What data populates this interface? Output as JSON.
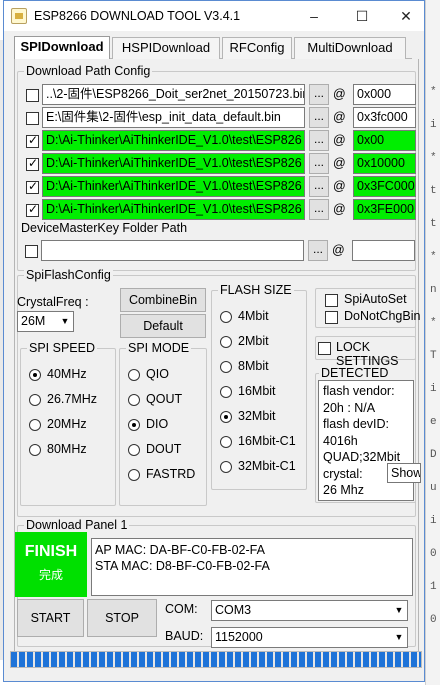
{
  "window": {
    "title": "ESP8266 DOWNLOAD TOOL V3.4.1",
    "minimize": "–",
    "maximize": "☐",
    "close": "✕"
  },
  "tabs": [
    {
      "label": "SPIDownload",
      "active": true
    },
    {
      "label": "HSPIDownload",
      "active": false
    },
    {
      "label": "RFConfig",
      "active": false
    },
    {
      "label": "MultiDownload",
      "active": false
    }
  ],
  "download_path_config": {
    "label": "Download Path Config",
    "rows": [
      {
        "checked": false,
        "path": "..\\2-固件\\ESP8266_Doit_ser2net_20150723.bin",
        "address": "0x000",
        "highlight": false
      },
      {
        "checked": false,
        "path": "E:\\固件集\\2-固件\\esp_init_data_default.bin",
        "address": "0x3fc000",
        "highlight": false
      },
      {
        "checked": true,
        "path": "D:\\Ai-Thinker\\AiThinkerIDE_V1.0\\test\\ESP826",
        "address": "0x00",
        "highlight": true
      },
      {
        "checked": true,
        "path": "D:\\Ai-Thinker\\AiThinkerIDE_V1.0\\test\\ESP826",
        "address": "0x10000",
        "highlight": true
      },
      {
        "checked": true,
        "path": "D:\\Ai-Thinker\\AiThinkerIDE_V1.0\\test\\ESP826",
        "address": "0x3FC000",
        "highlight": true
      },
      {
        "checked": true,
        "path": "D:\\Ai-Thinker\\AiThinkerIDE_V1.0\\test\\ESP826",
        "address": "0x3FE000",
        "highlight": true
      }
    ],
    "browse_label": "...",
    "at_symbol": "@",
    "device_master_key_label": "DeviceMasterKey Folder Path",
    "device_master_key_path": "",
    "device_master_key_address": ""
  },
  "spi_flash_config": {
    "label": "SpiFlashConfig",
    "crystal_freq_label": "CrystalFreq :",
    "crystal_freq_value": "26M",
    "combine_bin_label": "CombineBin",
    "default_label": "Default",
    "spi_speed": {
      "label": "SPI SPEED",
      "options": [
        "40MHz",
        "26.7MHz",
        "20MHz",
        "80MHz"
      ],
      "selected": "40MHz"
    },
    "spi_mode": {
      "label": "SPI MODE",
      "options": [
        "QIO",
        "QOUT",
        "DIO",
        "DOUT",
        "FASTRD"
      ],
      "selected": "DIO"
    },
    "flash_size": {
      "label": "FLASH SIZE",
      "options": [
        "4Mbit",
        "2Mbit",
        "8Mbit",
        "16Mbit",
        "32Mbit",
        "16Mbit-C1",
        "32Mbit-C1"
      ],
      "selected": "32Mbit"
    },
    "spi_auto_set": {
      "label": "SpiAutoSet",
      "checked": false
    },
    "do_not_chg_bin": {
      "label": "DoNotChgBin",
      "checked": false
    },
    "lock_settings": {
      "label": "LOCK SETTINGS",
      "checked": false
    },
    "detected_info": {
      "label": "DETECTED INFO",
      "lines": [
        "flash vendor:",
        "20h : N/A",
        "flash devID:",
        "4016h",
        "QUAD;32Mbit",
        "crystal:",
        "26 Mhz"
      ]
    },
    "tooltip": "Show the"
  },
  "download_panel": {
    "label": "Download Panel 1",
    "status": "FINISH",
    "status_sub": "完成",
    "status_color": "#00e000",
    "ap_mac": "AP  MAC:  DA-BF-C0-FB-02-FA",
    "sta_mac": "STA MAC:  D8-BF-C0-FB-02-FA",
    "start_label": "START",
    "stop_label": "STOP",
    "com_label": "COM:",
    "com_value": "COM3",
    "baud_label": "BAUD:",
    "baud_value": "1152000"
  },
  "progress": {
    "fraction": 1.0,
    "color": "#1e73d8"
  },
  "background_editor": {
    "glyphs": [
      "*",
      "i",
      "*",
      "t",
      "t",
      "*",
      "n",
      "*",
      "T",
      "i",
      "e",
      "D",
      "u",
      "i",
      "0",
      "1",
      "0"
    ]
  }
}
